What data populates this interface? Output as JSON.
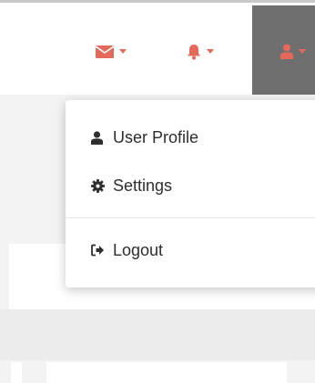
{
  "colors": {
    "accent": "#e5695b",
    "active_nav_bg": "#6f6f6f",
    "menu_text": "#2e2e2e"
  },
  "navbar": {
    "mail": {
      "icon": "envelope-icon"
    },
    "notifications": {
      "icon": "bell-icon"
    },
    "user": {
      "icon": "user-icon",
      "active": true
    }
  },
  "user_menu": {
    "items": [
      {
        "label": "User Profile",
        "icon": "user-icon"
      },
      {
        "label": "Settings",
        "icon": "gear-icon"
      },
      {
        "label": "Logout",
        "icon": "logout-icon"
      }
    ]
  }
}
